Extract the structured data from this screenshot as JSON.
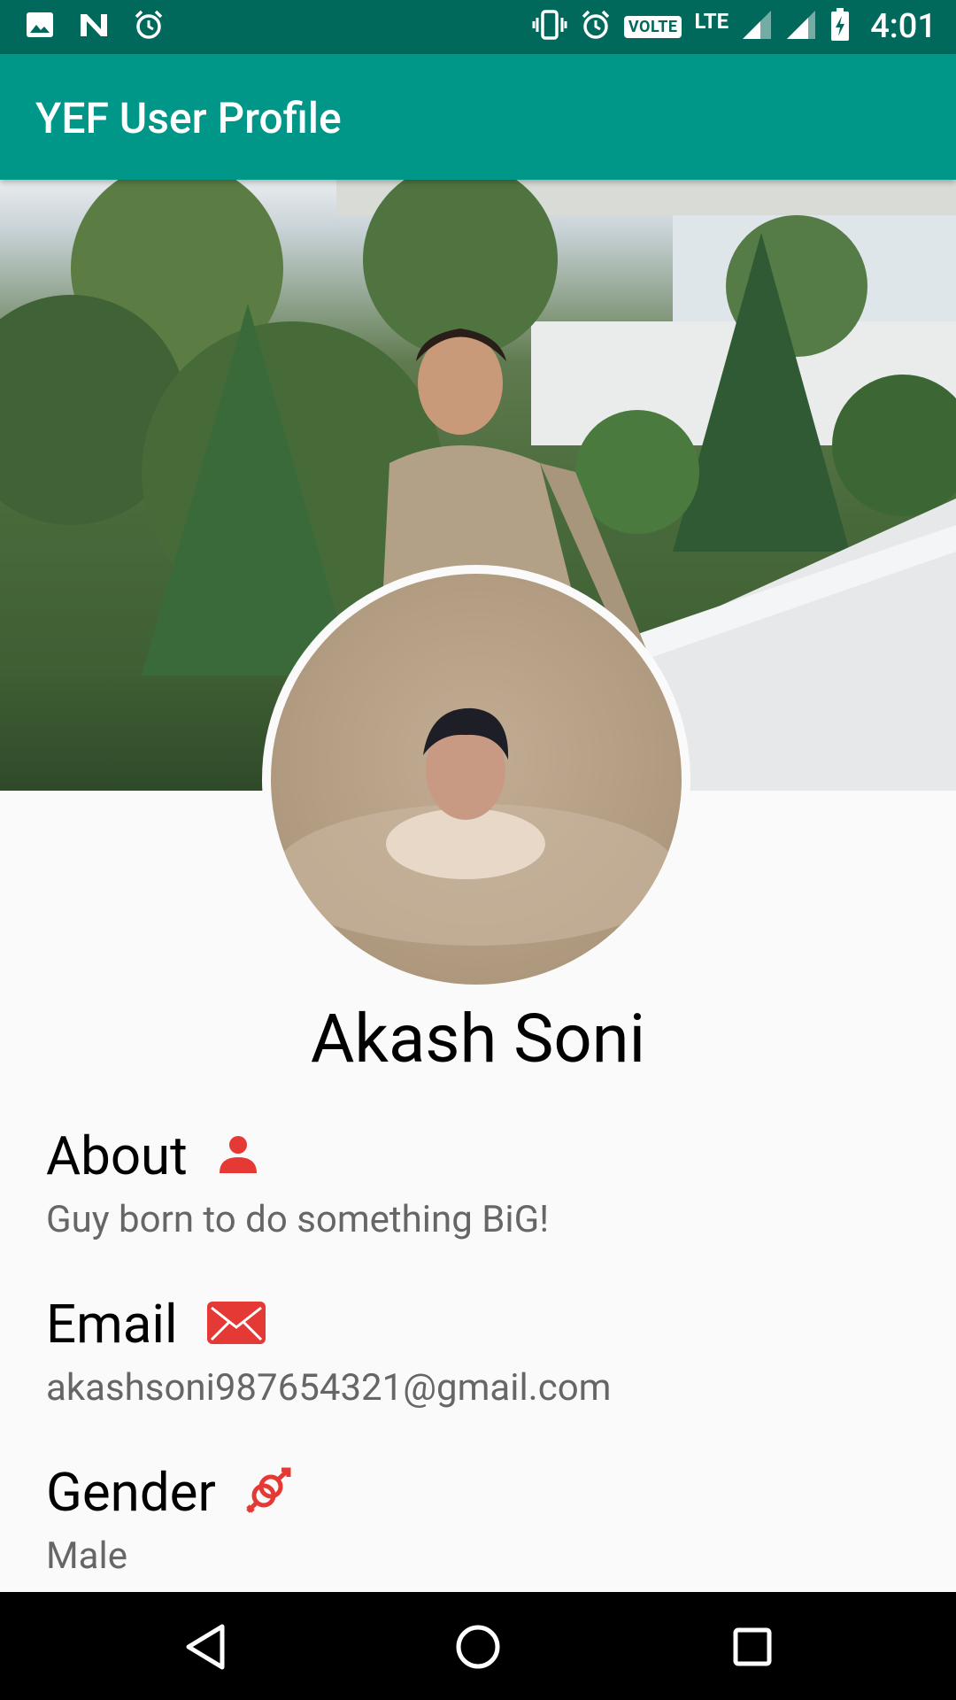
{
  "status_bar": {
    "left_icons": [
      "image-icon",
      "n-logo-icon",
      "alarm-icon"
    ],
    "right_icons": [
      "vibrate-icon",
      "alarm-icon",
      "signal-icon",
      "signal-icon",
      "battery-charging-icon"
    ],
    "volte": "VOLTE",
    "network": "LTE",
    "time": "4:01",
    "color": "#00695c"
  },
  "app_bar": {
    "title": "YEF User Profile",
    "color": "#009688"
  },
  "profile": {
    "name": "Akash Soni",
    "sections": [
      {
        "title": "About",
        "icon": "person-icon",
        "value": "Guy born to do something BiG!"
      },
      {
        "title": "Email",
        "icon": "envelope-icon",
        "value": "akashsoni987654321@gmail.com"
      },
      {
        "title": "Gender",
        "icon": "gender-icon",
        "value": "Male"
      }
    ],
    "accent": "#e53935"
  },
  "nav_bar": {
    "buttons": [
      "back-icon",
      "home-icon",
      "recents-icon"
    ]
  }
}
